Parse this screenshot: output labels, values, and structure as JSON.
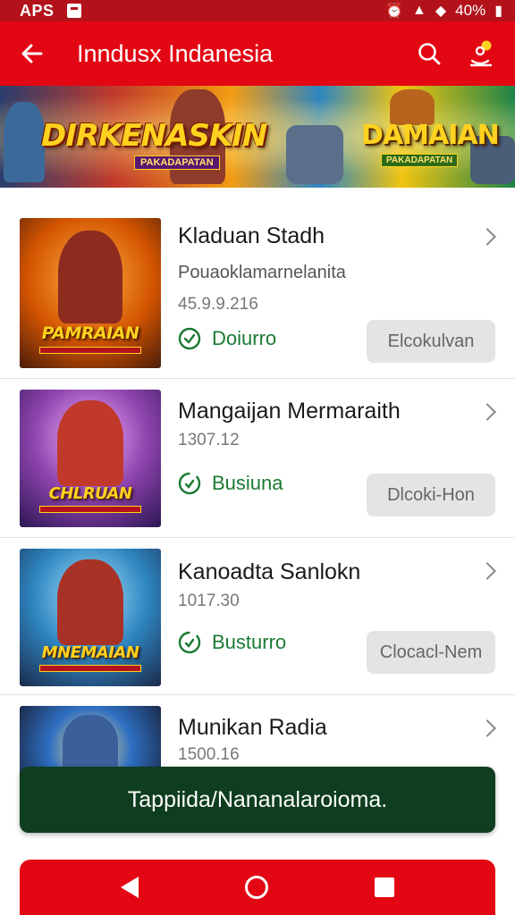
{
  "status_bar": {
    "left_label": "APS",
    "battery": "40%",
    "right_glyphs": "ɬ ɾʘ"
  },
  "app_bar": {
    "title": "Inndusx Indanesia"
  },
  "banner": {
    "title_left": "DIRKENASKIN",
    "subtitle_left": "PAKADAPATAN",
    "title_right": "DAMAIAN",
    "subtitle_right": "PAKADAPATAN"
  },
  "items": [
    {
      "title": "Kladuan Stadh",
      "subtitle": "Pouaoklamarnelanita",
      "size": "45.9.9.216",
      "status": "Doiurro",
      "action": "Elcokulvan",
      "thumb_label": "PAMRAIAN"
    },
    {
      "title": "Mangaijan Mermaraith",
      "subtitle": "",
      "size": "1307.12",
      "status": "Busiuna",
      "action": "Dlcoki-Hon",
      "thumb_label": "CHLRUAN"
    },
    {
      "title": "Kanoadta Sanlokn",
      "subtitle": "",
      "size": "1017.30",
      "status": "Busturro",
      "action": "Clocacl-Nem",
      "thumb_label": "MNEMAIAN"
    },
    {
      "title": "Munikan Radia",
      "subtitle": "",
      "size": "1500.16",
      "status": "",
      "action": "",
      "thumb_label": ""
    }
  ],
  "toast": {
    "message": "Tappiida/Nananalaroioma."
  },
  "colors": {
    "primary_red": "#e30613",
    "dark_red": "#b3121b",
    "success_green": "#1b7a32",
    "toast_bg": "#0f3d1f"
  }
}
